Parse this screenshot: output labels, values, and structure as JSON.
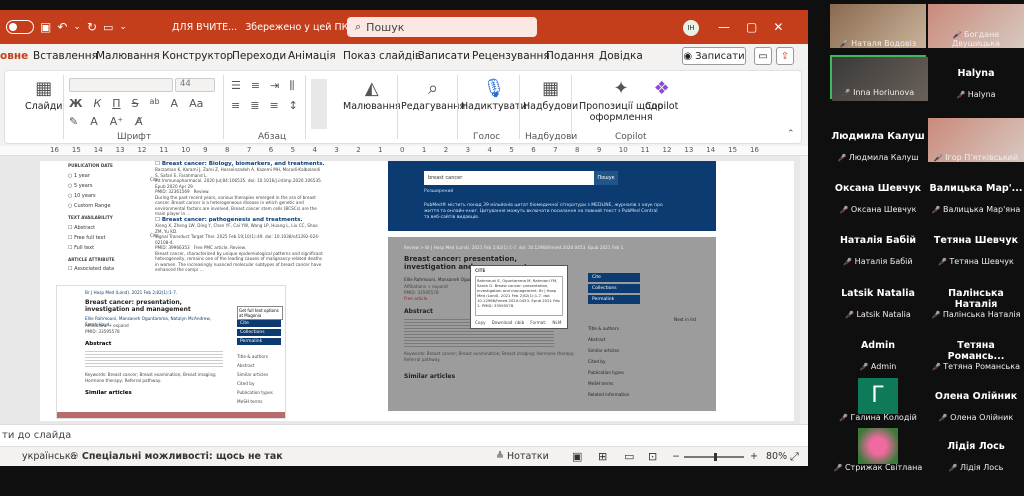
{
  "titlebar": {
    "doc_title": "ДЛЯ ВЧИТЕ...",
    "saved": "Збережено у цей ПК",
    "search_placeholder": "Пошук",
    "user_initials": "IH"
  },
  "tabs": [
    {
      "label": "овне"
    },
    {
      "label": "Вставлення"
    },
    {
      "label": "Малювання"
    },
    {
      "label": "Конструктор"
    },
    {
      "label": "Переходи"
    },
    {
      "label": "Анімація"
    },
    {
      "label": "Показ слайдів"
    },
    {
      "label": "Записати"
    },
    {
      "label": "Рецензування"
    },
    {
      "label": "Подання"
    },
    {
      "label": "Довідка"
    }
  ],
  "tab_actions": {
    "write": "Записати"
  },
  "ribbon": {
    "slides": "Слайди",
    "font_size": "44",
    "font_group": "Шрифт",
    "para_group": "Абзац",
    "drawing": "Малювання",
    "editing": "Редагування",
    "dictate": "Надиктувати",
    "voice_group": "Голос",
    "addins": "Надбудови",
    "addins_group": "Надбудови",
    "designer1": "Пропозиції щодо",
    "designer2": "оформлення",
    "copilot": "Copilot",
    "copilot_group": "Copilot",
    "fmt": {
      "bold": "Ж",
      "italic": "К",
      "underline": "П",
      "strike": "S",
      "sub": "ab"
    }
  },
  "ruler": [
    "16",
    "15",
    "14",
    "13",
    "12",
    "11",
    "10",
    "9",
    "8",
    "7",
    "6",
    "5",
    "4",
    "3",
    "2",
    "1",
    "0",
    "1",
    "2",
    "3",
    "4",
    "5",
    "6",
    "7",
    "8",
    "9",
    "10",
    "11",
    "12",
    "13",
    "14",
    "15",
    "16"
  ],
  "slide": {
    "filters": {
      "date_title": "PUBLICATION DATE",
      "dates": [
        "1 year",
        "5 years",
        "10 years",
        "Custom Range"
      ],
      "text_title": "TEXT AVAILABILITY",
      "texts": [
        "Abstract",
        "Free full text",
        "Full text"
      ],
      "attr_title": "ARTICLE ATTRIBUTE",
      "attrs": [
        "Associated data"
      ]
    },
    "results": [
      {
        "title": "Breast cancer: Biology, biomarkers, and treatments.",
        "authors": "Barzaman K, Karami J, Zarei Z, Hosseinzadeh A, Kazemi MH, Moradi-Kalbolandi S, Safari E, Farahmand L.",
        "journal": "Int Immunopharmacol. 2020 Jul;84:106535. doi: 10.1016/j.intimp.2020.106535. Epub 2020 Apr 29.",
        "pmid": "PMID: 32361569",
        "type": "Review.",
        "cite": "Cite",
        "snippet": "During the past recent years, various therapies emerged in the era of breast cancer. Breast cancer is a heterogeneous disease in which genetic and environmental factors are involved. Breast cancer stem cells (BCSCs) are the main player in ..."
      },
      {
        "title": "Breast cancer: pathogenesis and treatments.",
        "authors": "Xiong X, Zheng LW, Ding Y, Chen YF, Cai YW, Wang LP, Huang L, Liu CC, Shao ZM, Yu KD.",
        "journal": "Signal Transduct Target Ther. 2025 Feb 19;10(1):49. doi: 10.1038/s41392-024-02108-4.",
        "pmid": "PMID: 39966353",
        "type": "Free PMC article.  Review.",
        "cite": "Cite",
        "snippet": "Breast cancer, characterized by unique epidemiological patterns and significant heterogeneity, remains one of the leading causes of malignancy-related deaths in women. The increasingly nuanced molecular subtypes of breast cancer have enhanced the compr ..."
      }
    ],
    "article_small": {
      "journal": "Br J Hosp Med (Lond). 2021 Feb 2;82(1):1-7.",
      "title": "Breast cancer: presentation, investigation and management",
      "authors": "Ellie Rahmouni, Mansaneh Oguntamma, Natalyn McAndrew, Sarah Hayd",
      "affiliations": "Affiliations + expand",
      "pmid": "PMID: 33595578",
      "abstract": "Abstract",
      "similar": "Similar articles",
      "keywords": "Keywords: Breast cancer; Breast examination; Breast imaging; Hormone therapy; Referral pathway.",
      "tooltip": "Get full text options at Magonia"
    },
    "pubmed": {
      "search_value": "breast cancer",
      "search_button": "Пошук",
      "advanced": "Розширений",
      "banner": "PubMed® містить понад 39 мільйонів цитат біомедичної літератури з MEDLINE, журналів з наук про життя та онлайн-книг. Цитування можуть включати посилання на повний текст з PubMed Central та веб-сайтів видавців."
    },
    "article_big": {
      "meta": "Review  > Br J Hosp Med (Lond). 2021 Feb 2;82(1):1-7.  doi: 10.12968/hmed.2020.0453. Epub 2021 Feb 1.",
      "title": "Breast cancer: presentation, investigation and management",
      "authors": "Ellie Rahmouni, Mansaneh Oguntamma, Natalyn McAndrew, Sarah Hayd",
      "affiliations": "Affiliations + expand",
      "pmid": "PMID: 33595578",
      "free": "Free article",
      "abstract": "Abstract",
      "keywords": "Keywords: Breast cancer; Breast examination; Breast imaging; Hormone therapy; Referral pathway.",
      "similar": "Similar articles",
      "next": "Next in list",
      "cite_dialog": {
        "title": "CITE",
        "text": "Rahmouni E, Oguntamma M, Rahmani FM, Sarah G. Breast cancer: presentation, investigation and management. Br J Hosp Med (Lond). 2021 Feb 2;82(1):1-7. doi: 10.12968/hmed.2020.0453. Epub 2021 Feb 1. PMID: 33595578.",
        "copy": "Copy",
        "download": "Download .nbib",
        "format": "Format:",
        "format_value": "NLM"
      },
      "sidebar": [
        "Cite",
        "Collections",
        "Permalink"
      ],
      "page_nav": [
        "Title & authors",
        "Abstract",
        "Similar articles",
        "Cited by",
        "Publication types",
        "MeSH terms",
        "Related information",
        "LinkOut - more resources"
      ]
    }
  },
  "notes": "ти до слайда",
  "status": {
    "lang": "українська",
    "accessibility": "Спеціальні можливості: щось не так",
    "notes": "Нотатки",
    "zoom": "80%"
  },
  "participants": [
    {
      "name": "Наталя Водовіз",
      "avatar": "photo",
      "label": "Наталя Водовіз"
    },
    {
      "name": "Богдана Двушицька",
      "avatar": "photo",
      "label": "Богдана Двушицька"
    },
    {
      "name": "Inna Horiunova",
      "avatar": "photo",
      "label": "Inna Horiunova"
    },
    {
      "name": "Halyna",
      "avatar": "none",
      "label": "Halyna"
    },
    {
      "name": "Людмила Калуш",
      "avatar": "none",
      "label": "Людмила Калуш"
    },
    {
      "name": "Ігор П'ятківський",
      "avatar": "photo",
      "label": "Ігор П'ятківський"
    },
    {
      "name": "Оксана Шевчук",
      "avatar": "none",
      "label": "Оксана Шевчук"
    },
    {
      "name": "Валицька Мар'...",
      "avatar": "none",
      "label": "Валицька Мар'яна"
    },
    {
      "name": "Наталія Бабій",
      "avatar": "none",
      "label": "Наталія Бабій"
    },
    {
      "name": "Тетяна Шевчук",
      "avatar": "none",
      "label": "Тетяна Шевчук"
    },
    {
      "name": "Latsik Natalia",
      "avatar": "none",
      "label": "Latsik Natalia"
    },
    {
      "name": "Палінська Наталія",
      "avatar": "none",
      "label": "Палінська Наталія"
    },
    {
      "name": "Admin",
      "avatar": "none",
      "label": "Admin"
    },
    {
      "name": "Тетяна Романсь...",
      "avatar": "none",
      "label": "Тетяна Романська"
    },
    {
      "name": "Галина Колодій",
      "avatar": "letter",
      "letter": "Г",
      "label": "Галина Колодій"
    },
    {
      "name": "Олена Олійник",
      "avatar": "none",
      "label": "Олена Олійник"
    },
    {
      "name": "Стрижак Світлана",
      "avatar": "flower",
      "label": "Стрижак Світлана"
    },
    {
      "name": "Лідія Лось",
      "avatar": "none",
      "label": "Лідія Лось"
    }
  ],
  "colors": {
    "accent": "#c43e1c",
    "pubmed_blue": "#0b3b70",
    "speaker_border": "#3dbb5a",
    "letter_avatar": "#0f7a5a"
  }
}
